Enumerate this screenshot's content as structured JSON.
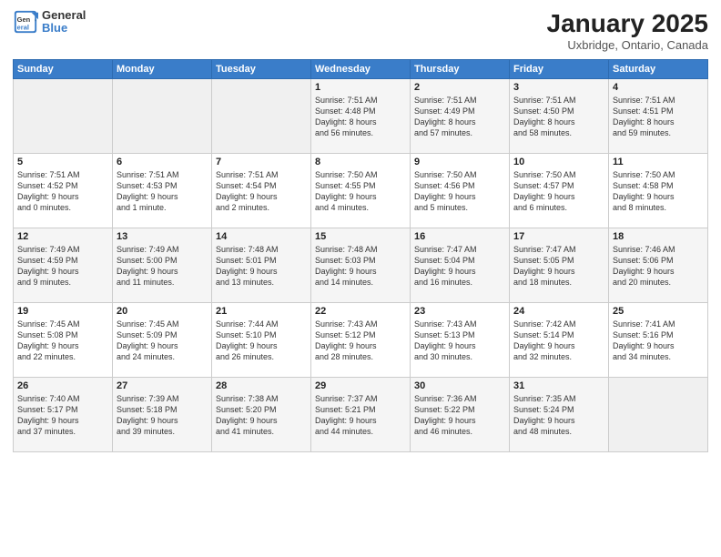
{
  "header": {
    "logo_line1": "General",
    "logo_line2": "Blue",
    "month": "January 2025",
    "location": "Uxbridge, Ontario, Canada"
  },
  "days_of_week": [
    "Sunday",
    "Monday",
    "Tuesday",
    "Wednesday",
    "Thursday",
    "Friday",
    "Saturday"
  ],
  "weeks": [
    [
      {
        "num": "",
        "info": ""
      },
      {
        "num": "",
        "info": ""
      },
      {
        "num": "",
        "info": ""
      },
      {
        "num": "1",
        "info": "Sunrise: 7:51 AM\nSunset: 4:48 PM\nDaylight: 8 hours\nand 56 minutes."
      },
      {
        "num": "2",
        "info": "Sunrise: 7:51 AM\nSunset: 4:49 PM\nDaylight: 8 hours\nand 57 minutes."
      },
      {
        "num": "3",
        "info": "Sunrise: 7:51 AM\nSunset: 4:50 PM\nDaylight: 8 hours\nand 58 minutes."
      },
      {
        "num": "4",
        "info": "Sunrise: 7:51 AM\nSunset: 4:51 PM\nDaylight: 8 hours\nand 59 minutes."
      }
    ],
    [
      {
        "num": "5",
        "info": "Sunrise: 7:51 AM\nSunset: 4:52 PM\nDaylight: 9 hours\nand 0 minutes."
      },
      {
        "num": "6",
        "info": "Sunrise: 7:51 AM\nSunset: 4:53 PM\nDaylight: 9 hours\nand 1 minute."
      },
      {
        "num": "7",
        "info": "Sunrise: 7:51 AM\nSunset: 4:54 PM\nDaylight: 9 hours\nand 2 minutes."
      },
      {
        "num": "8",
        "info": "Sunrise: 7:50 AM\nSunset: 4:55 PM\nDaylight: 9 hours\nand 4 minutes."
      },
      {
        "num": "9",
        "info": "Sunrise: 7:50 AM\nSunset: 4:56 PM\nDaylight: 9 hours\nand 5 minutes."
      },
      {
        "num": "10",
        "info": "Sunrise: 7:50 AM\nSunset: 4:57 PM\nDaylight: 9 hours\nand 6 minutes."
      },
      {
        "num": "11",
        "info": "Sunrise: 7:50 AM\nSunset: 4:58 PM\nDaylight: 9 hours\nand 8 minutes."
      }
    ],
    [
      {
        "num": "12",
        "info": "Sunrise: 7:49 AM\nSunset: 4:59 PM\nDaylight: 9 hours\nand 9 minutes."
      },
      {
        "num": "13",
        "info": "Sunrise: 7:49 AM\nSunset: 5:00 PM\nDaylight: 9 hours\nand 11 minutes."
      },
      {
        "num": "14",
        "info": "Sunrise: 7:48 AM\nSunset: 5:01 PM\nDaylight: 9 hours\nand 13 minutes."
      },
      {
        "num": "15",
        "info": "Sunrise: 7:48 AM\nSunset: 5:03 PM\nDaylight: 9 hours\nand 14 minutes."
      },
      {
        "num": "16",
        "info": "Sunrise: 7:47 AM\nSunset: 5:04 PM\nDaylight: 9 hours\nand 16 minutes."
      },
      {
        "num": "17",
        "info": "Sunrise: 7:47 AM\nSunset: 5:05 PM\nDaylight: 9 hours\nand 18 minutes."
      },
      {
        "num": "18",
        "info": "Sunrise: 7:46 AM\nSunset: 5:06 PM\nDaylight: 9 hours\nand 20 minutes."
      }
    ],
    [
      {
        "num": "19",
        "info": "Sunrise: 7:45 AM\nSunset: 5:08 PM\nDaylight: 9 hours\nand 22 minutes."
      },
      {
        "num": "20",
        "info": "Sunrise: 7:45 AM\nSunset: 5:09 PM\nDaylight: 9 hours\nand 24 minutes."
      },
      {
        "num": "21",
        "info": "Sunrise: 7:44 AM\nSunset: 5:10 PM\nDaylight: 9 hours\nand 26 minutes."
      },
      {
        "num": "22",
        "info": "Sunrise: 7:43 AM\nSunset: 5:12 PM\nDaylight: 9 hours\nand 28 minutes."
      },
      {
        "num": "23",
        "info": "Sunrise: 7:43 AM\nSunset: 5:13 PM\nDaylight: 9 hours\nand 30 minutes."
      },
      {
        "num": "24",
        "info": "Sunrise: 7:42 AM\nSunset: 5:14 PM\nDaylight: 9 hours\nand 32 minutes."
      },
      {
        "num": "25",
        "info": "Sunrise: 7:41 AM\nSunset: 5:16 PM\nDaylight: 9 hours\nand 34 minutes."
      }
    ],
    [
      {
        "num": "26",
        "info": "Sunrise: 7:40 AM\nSunset: 5:17 PM\nDaylight: 9 hours\nand 37 minutes."
      },
      {
        "num": "27",
        "info": "Sunrise: 7:39 AM\nSunset: 5:18 PM\nDaylight: 9 hours\nand 39 minutes."
      },
      {
        "num": "28",
        "info": "Sunrise: 7:38 AM\nSunset: 5:20 PM\nDaylight: 9 hours\nand 41 minutes."
      },
      {
        "num": "29",
        "info": "Sunrise: 7:37 AM\nSunset: 5:21 PM\nDaylight: 9 hours\nand 44 minutes."
      },
      {
        "num": "30",
        "info": "Sunrise: 7:36 AM\nSunset: 5:22 PM\nDaylight: 9 hours\nand 46 minutes."
      },
      {
        "num": "31",
        "info": "Sunrise: 7:35 AM\nSunset: 5:24 PM\nDaylight: 9 hours\nand 48 minutes."
      },
      {
        "num": "",
        "info": ""
      }
    ]
  ]
}
